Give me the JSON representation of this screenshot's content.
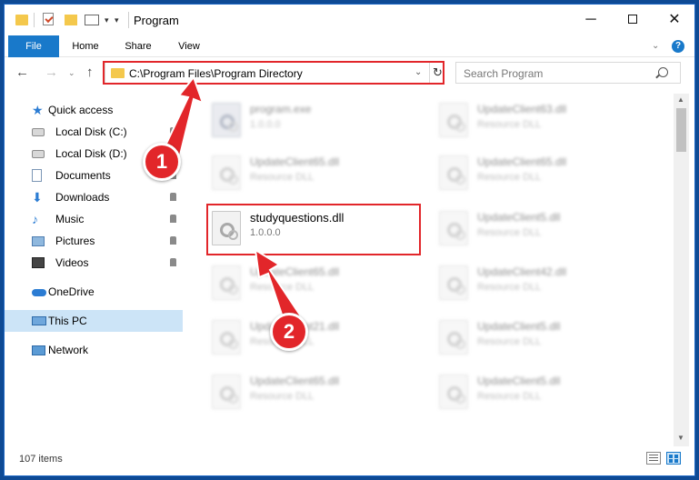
{
  "window": {
    "title": "Program",
    "min_glyph": "─",
    "close_glyph": "✕"
  },
  "quick_access_toolbar": {
    "dropdown_glyph": "▾",
    "customize_glyph": "▾"
  },
  "ribbon": {
    "tabs": [
      {
        "label": "File",
        "active": true
      },
      {
        "label": "Home"
      },
      {
        "label": "Share"
      },
      {
        "label": "View"
      }
    ],
    "expand_glyph": "⌄",
    "help_glyph": "?"
  },
  "navigation": {
    "back_glyph": "←",
    "forward_glyph": "→",
    "recent_glyph": "⌄",
    "up_glyph": "↑",
    "address": "C:\\Program Files\\Program Directory",
    "address_dropdown_glyph": "⌄",
    "refresh_glyph": "↻",
    "search_placeholder": "Search Program"
  },
  "sidebar": {
    "items": [
      {
        "label": "Quick access",
        "icon": "star-icon",
        "pinned": false
      },
      {
        "label": "Local Disk (C:)",
        "icon": "drive-icon",
        "pinned": true
      },
      {
        "label": "Local Disk (D:)",
        "icon": "drive-icon",
        "pinned": true
      },
      {
        "label": "Documents",
        "icon": "document-icon",
        "pinned": true
      },
      {
        "label": "Downloads",
        "icon": "download-icon",
        "pinned": true
      },
      {
        "label": "Music",
        "icon": "music-icon",
        "pinned": true
      },
      {
        "label": "Pictures",
        "icon": "pictures-icon",
        "pinned": true
      },
      {
        "label": "Videos",
        "icon": "videos-icon",
        "pinned": true
      },
      {
        "label": "OneDrive",
        "icon": "cloud-icon",
        "pinned": false
      },
      {
        "label": "This PC",
        "icon": "computer-icon",
        "pinned": false,
        "selected": true
      },
      {
        "label": "Network",
        "icon": "network-icon",
        "pinned": false
      }
    ]
  },
  "files": [
    {
      "name": "program.exe",
      "sub": "1.0.0.0"
    },
    {
      "name": "UpdateClient63.dll",
      "sub": "Resource DLL"
    },
    {
      "name": "UpdateClient65.dll",
      "sub": "Resource DLL"
    },
    {
      "name": "UpdateClient65.dll",
      "sub": "Resource DLL"
    },
    {
      "name": "studyquestions.dll",
      "sub": "1.0.0.0"
    },
    {
      "name": "UpdateClient5.dll",
      "sub": "Resource DLL"
    },
    {
      "name": "UpdateClient65.dll",
      "sub": "Resource DLL"
    },
    {
      "name": "UpdateClient42.dll",
      "sub": "Resource DLL"
    },
    {
      "name": "UpdateClient21.dll",
      "sub": "Resource DLL"
    },
    {
      "name": "UpdateClient5.dll",
      "sub": "Resource DLL"
    },
    {
      "name": "UpdateClient65.dll",
      "sub": "Resource DLL"
    },
    {
      "name": "UpdateClient5.dll",
      "sub": "Resource DLL"
    }
  ],
  "scrollbar": {
    "up_glyph": "▲",
    "down_glyph": "▼"
  },
  "status": {
    "item_count": "107 items"
  },
  "callouts": {
    "step1": "1",
    "step2": "2",
    "color": "#e2262a"
  }
}
